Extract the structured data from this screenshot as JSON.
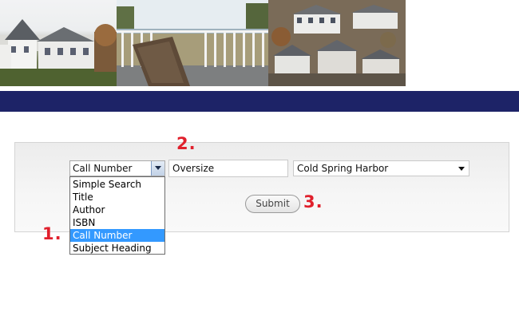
{
  "search": {
    "field_selected": "Call Number",
    "field_options": [
      "Simple Search",
      "Title",
      "Author",
      "ISBN",
      "Call Number",
      "Subject Heading"
    ],
    "selected_option_index": 4,
    "term_value": "Oversize",
    "library_selected": "Cold Spring Harbor",
    "submit_label": "Submit"
  },
  "annotations": {
    "marker_1": "1.",
    "marker_2": "2.",
    "marker_3": "3."
  },
  "colors": {
    "navbar": "#1d2367",
    "selection_highlight": "#3399ff",
    "annotation_red": "#e0202c"
  }
}
